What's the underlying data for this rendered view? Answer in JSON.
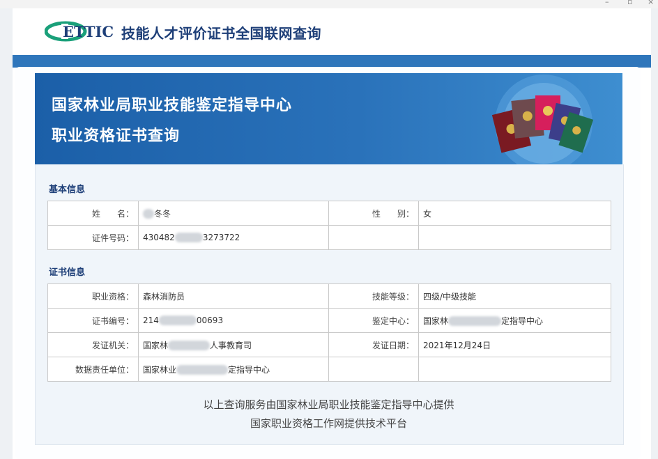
{
  "window": {
    "minimize": "–",
    "maximize": "▫",
    "close": "×"
  },
  "header": {
    "logo_text": "ETTIC",
    "title": "技能人才评价证书全国联网查询"
  },
  "banner": {
    "line1": "国家林业局职业技能鉴定指导中心",
    "line2": "职业资格证书查询"
  },
  "basic": {
    "title": "基本信息",
    "name_label": "姓　　名：",
    "name_value": "冬冬",
    "gender_label": "性　　别：",
    "gender_value": "女",
    "id_label": "证件号码：",
    "id_prefix": "430482",
    "id_suffix": "3273722"
  },
  "cert": {
    "title": "证书信息",
    "qual_label": "职业资格：",
    "qual_value": "森林消防员",
    "level_label": "技能等级：",
    "level_value": "四级/中级技能",
    "no_label": "证书编号：",
    "no_prefix": "214",
    "no_suffix": "00693",
    "center_label": "鉴定中心：",
    "center_prefix": "国家林",
    "center_suffix": "定指导中心",
    "issuer_label": "发证机关：",
    "issuer_prefix": "国家林",
    "issuer_suffix": "人事教育司",
    "date_label": "发证日期：",
    "date_value": "2021年12月24日",
    "resp_label": "数据责任单位：",
    "resp_prefix": "国家林业",
    "resp_suffix": "定指导中心"
  },
  "footer": {
    "line1": "以上查询服务由国家林业局职业技能鉴定指导中心提供",
    "line2": "国家职业资格工作网提供技术平台"
  },
  "colors": {
    "brand_blue": "#2f76bb",
    "title_navy": "#1e3f78",
    "logo_green": "#1aa07a"
  }
}
